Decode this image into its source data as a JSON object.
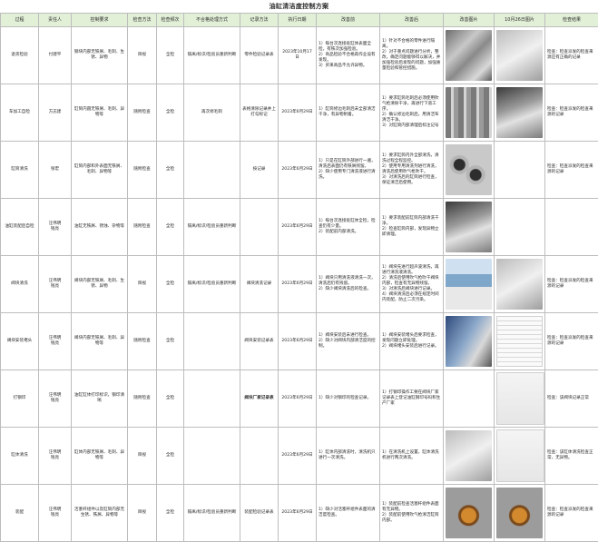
{
  "title": "油缸清洁度控制方案",
  "headers": [
    "过程",
    "责任人",
    "控制要求",
    "检查方法",
    "检查频次",
    "不合格处理方式",
    "记录方法",
    "执行日期",
    "改善前",
    "改善后",
    "改善图片",
    "10月26日图片",
    "检查结果"
  ],
  "rows": [
    {
      "process": "退货检验",
      "owner": "付建平",
      "requirement": "钢块内部无铁屑、毛刺、生锈、异物",
      "method": "目视",
      "frequency": "全检",
      "nonconform": "隔离/标识/检验员重新判断",
      "record": "零件检验记录表",
      "date": "2023年10月17日",
      "before": "1）每台次连接处缸体表面全检，有铁次加强检验。\n2）商品检验不合格再作业设有发现。\n3）买来商品不允许异物。",
      "after": "1）针对不合格的零件进行隔离。\n2）对于重点问题进行分析，整改，确定问题能够得以解决，并加强检验后发现的问题，加强质量检验和管控措施。",
      "result": "检查：检查派发的检查来源应有正确的记录"
    },
    {
      "process": "车加工自检",
      "owner": "方志建",
      "requirement": "缸筒内圆无铁屑、毛刺、异物等",
      "method": "随附检查",
      "frequency": "全检",
      "nonconform": "再次修毛刺",
      "record": "表格清除记录并上打勾标记",
      "date": "2023年6月29日",
      "before": "1）缸筒修边毛刺后未全部清洁干净，有异物附着。",
      "after": "1）要求缸筒毛刺后必须使用吹气枪清除干净，再进行下道工序。\n2）确认修边毛刺后，用清洁布清洁干净。\n3）对缸筒内部清理后标注记号",
      "result": "检查：检查派发的检查来源的记录"
    },
    {
      "process": "缸筒清洗",
      "owner": "张宏",
      "requirement": "缸筒内部和外表面无铁屑、毛刺、异物等",
      "method": "随附检查",
      "frequency": "全检",
      "nonconform": "",
      "record": "按记录",
      "date": "2023年6月29日",
      "before": "1）只是在缸筒外部进行一遍，清洗后表面仍有铁屑残留。\n2）缺少使用专门清洗液进行清洗。",
      "after": "1）要求缸筒内外全部清洗，清洗过程全程监控。\n2）使用专用清洗剂进行清洗，清洗后使用吹气枪吹干。\n3）对清洗后的缸筒进行检查，保证清洁后使用。",
      "result": "检查：检查派发的检查来源的记录"
    },
    {
      "process": "油缸装配后自检",
      "owner": "汪伟明\n钱亮",
      "requirement": "油缸无铁屑、锈蚀、杂物等",
      "method": "随附检查",
      "frequency": "全检",
      "nonconform": "隔离/标识/检验员重新判断",
      "record": "",
      "date": "2023年6月29日",
      "before": "1）每台次连接处缸体全检，检查仍有少量。\n2）装配前内部清洗。",
      "after": "1）要求装配前缸筒内部清洗干净。\n2）检查缸筒内部，发现异物立即清理。",
      "result": ""
    },
    {
      "process": "阀块清洗",
      "owner": "汪伟明\n钱亮",
      "requirement": "阀块内部无铁屑、毛刺、生锈、异物",
      "method": "目视",
      "frequency": "全检",
      "nonconform": "隔离/标识/检验员重新判断",
      "record": "阀块清洗记录",
      "date": "2023年6月29日",
      "before": "1）阀块只用清洗液清洗一次，清洗后仍有残留。\n2）缺少阀块清洗后的检查。",
      "after": "1）阀块先进行超声波清洗，再进行清洗液清洗。\n2）清洗后使用吹气枪吹干阀块内部，检查有无异物残留。\n3）对清洗后阀块进行记录。\n4）阀块清洗后必须在规定时间内装配，防止二次污染。",
      "result": "检查：检查派发的检查来源的记录"
    },
    {
      "process": "阀块安装堵头",
      "owner": "汪伟明\n钱亮",
      "requirement": "阀块内部无铁屑、毛刺、异物等",
      "method": "随附检查",
      "frequency": "全检",
      "nonconform": "",
      "record": "阀块安装记录表",
      "date": "2023年6月29日",
      "before": "1）阀块安装后未进行检查。\n2）缺少对阀块内部清洁度的控制。",
      "after": "1）阀块安装堵头后要求检查，发现问题立即处理。\n2）阀块堵头安装后进行记录。",
      "result": "检查：检查派发的检查来源的记录"
    },
    {
      "process": "打钢印",
      "owner": "汪伟明\n钱亮",
      "requirement": "油缸缸体打印标识，钢印清晰",
      "method": "随附检查",
      "frequency": "全检",
      "nonconform": "",
      "record": "阀块厂家记录表",
      "date": "2023年6月29日",
      "before": "1）缺少对钢印的检查记录。",
      "after": "1）打钢印操作工要在阀块厂家记录表上登记油缸钢印号码和生产厂家",
      "result": "检查：该阀块记录正常"
    },
    {
      "process": "缸体清洗",
      "owner": "汪伟明\n钱亮",
      "requirement": "缸体内部无铁屑、毛刺、异物等",
      "method": "目视",
      "frequency": "全检",
      "nonconform": "",
      "record": "",
      "date": "2023年6月29日",
      "before": "1）缸体内部清洗时，清洗机只进行一次清洗。",
      "after": "1）在清洗机上设置，缸体清洗机进行两次清洗。",
      "result": "检查：该缸体清洗检查正常，无异物。"
    },
    {
      "process": "装配",
      "owner": "汪伟明\n钱亮",
      "requirement": "活塞杆组件以及缸筒内部无生锈、铁屑、异物等",
      "method": "目视",
      "frequency": "全检",
      "nonconform": "隔离/标识/检验员重新判断",
      "record": "装配检验记录表",
      "date": "2023年6月29日",
      "before": "1）缺少对活塞杆组件表面的清洁度检查。",
      "after": "1）装配前检查活塞杆组件表面有无异物。\n2）装配前使用吹气枪清洁缸筒内部。",
      "result": "检查：检查派发的检查来源的记录"
    }
  ]
}
